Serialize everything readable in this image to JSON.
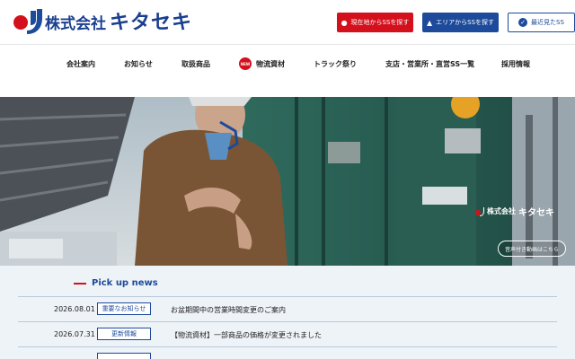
{
  "brand": {
    "company_prefix": "株式会社",
    "company_name": "キタセキ",
    "primary_color": "#1d4a9a",
    "accent_color": "#d3101c"
  },
  "header_buttons": {
    "current_location": {
      "label": "現在地からSSを探す",
      "icon": "pin-icon"
    },
    "area_search": {
      "label": "エリアからSSを探す",
      "icon": "map-icon"
    },
    "recently_viewed": {
      "label": "最近見たSS",
      "icon": "check-icon"
    }
  },
  "nav": {
    "items": [
      {
        "label": "会社案内"
      },
      {
        "label": "お知らせ"
      },
      {
        "label": "取扱商品"
      },
      {
        "label": "物流資材",
        "badge": "NEW"
      },
      {
        "label": "トラック祭り"
      },
      {
        "label": "支店・営業所・直営SS一覧"
      },
      {
        "label": "採用情報"
      }
    ]
  },
  "hero": {
    "logo_prefix": "株式会社",
    "logo_name": "キタセキ",
    "audio_button": "音声付き動画はこちら"
  },
  "news": {
    "heading": "Pick up news",
    "items": [
      {
        "date": "2026.08.01",
        "tag": "重要なお知らせ",
        "title": "お盆期間中の営業時間変更のご案内"
      },
      {
        "date": "2026.07.31",
        "tag": "更新情報",
        "title": "【物流資材】一部商品の価格が変更されました"
      }
    ]
  }
}
